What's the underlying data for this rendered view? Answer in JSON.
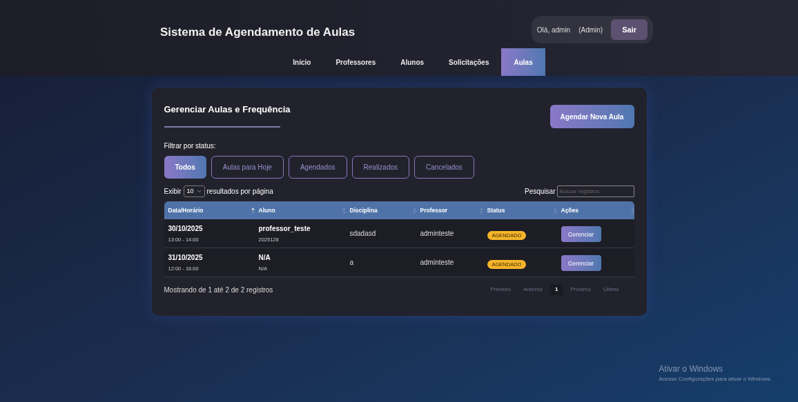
{
  "header": {
    "title": "Sistema de Agendamento de Aulas",
    "greeting": "Olá, admin",
    "role": "(Admin)",
    "logout": "Sair"
  },
  "nav": [
    {
      "label": "Início",
      "selected": false
    },
    {
      "label": "Professores",
      "selected": false
    },
    {
      "label": "Alunos",
      "selected": false
    },
    {
      "label": "Solicitações",
      "selected": false
    },
    {
      "label": "Aulas",
      "selected": true
    }
  ],
  "card": {
    "title": "Gerenciar Aulas e Frequência",
    "new_button": "Agendar Nova Aula"
  },
  "filter": {
    "label": "Filtrar por status:",
    "options": [
      {
        "label": "Todos",
        "selected": true
      },
      {
        "label": "Aulas para Hoje",
        "selected": false
      },
      {
        "label": "Agendados",
        "selected": false
      },
      {
        "label": "Realizados",
        "selected": false
      },
      {
        "label": "Cancelados",
        "selected": false
      }
    ]
  },
  "length": {
    "before": "Exibir",
    "value": "10",
    "after": "resultados por página"
  },
  "search": {
    "label": "Pesquisar",
    "placeholder": "Buscar registros"
  },
  "table": {
    "columns": [
      {
        "label": "Data/Horário",
        "sorted": true
      },
      {
        "label": "Aluno",
        "sorted": false
      },
      {
        "label": "Disciplina",
        "sorted": false
      },
      {
        "label": "Professor",
        "sorted": false
      },
      {
        "label": "Status",
        "sorted": false
      },
      {
        "label": "Ações",
        "sorted": false
      }
    ],
    "rows": [
      {
        "date": "30/10/2025",
        "time": "13:00 - 14:00",
        "student": "professor_teste",
        "student_id": "2025128",
        "subject": "sdadasd",
        "teacher": "adminteste",
        "status": "AGENDADO",
        "action": "Gerenciar"
      },
      {
        "date": "31/10/2025",
        "time": "12:00 - 16:00",
        "student": "N/A",
        "student_id": "N/A",
        "subject": "a",
        "teacher": "adminteste",
        "status": "AGENDADO",
        "action": "Gerenciar"
      }
    ]
  },
  "info": "Mostrando de 1 até 2 de 2 registros",
  "pagination": [
    {
      "label": "Primeiro",
      "selected": false
    },
    {
      "label": "Anterior",
      "selected": false
    },
    {
      "label": "1",
      "selected": true
    },
    {
      "label": "Próximo",
      "selected": false
    },
    {
      "label": "Último",
      "selected": false
    }
  ],
  "os_notice": {
    "title": "Ativar o Windows",
    "text": "Acesse Configurações para ativar o Windows."
  }
}
